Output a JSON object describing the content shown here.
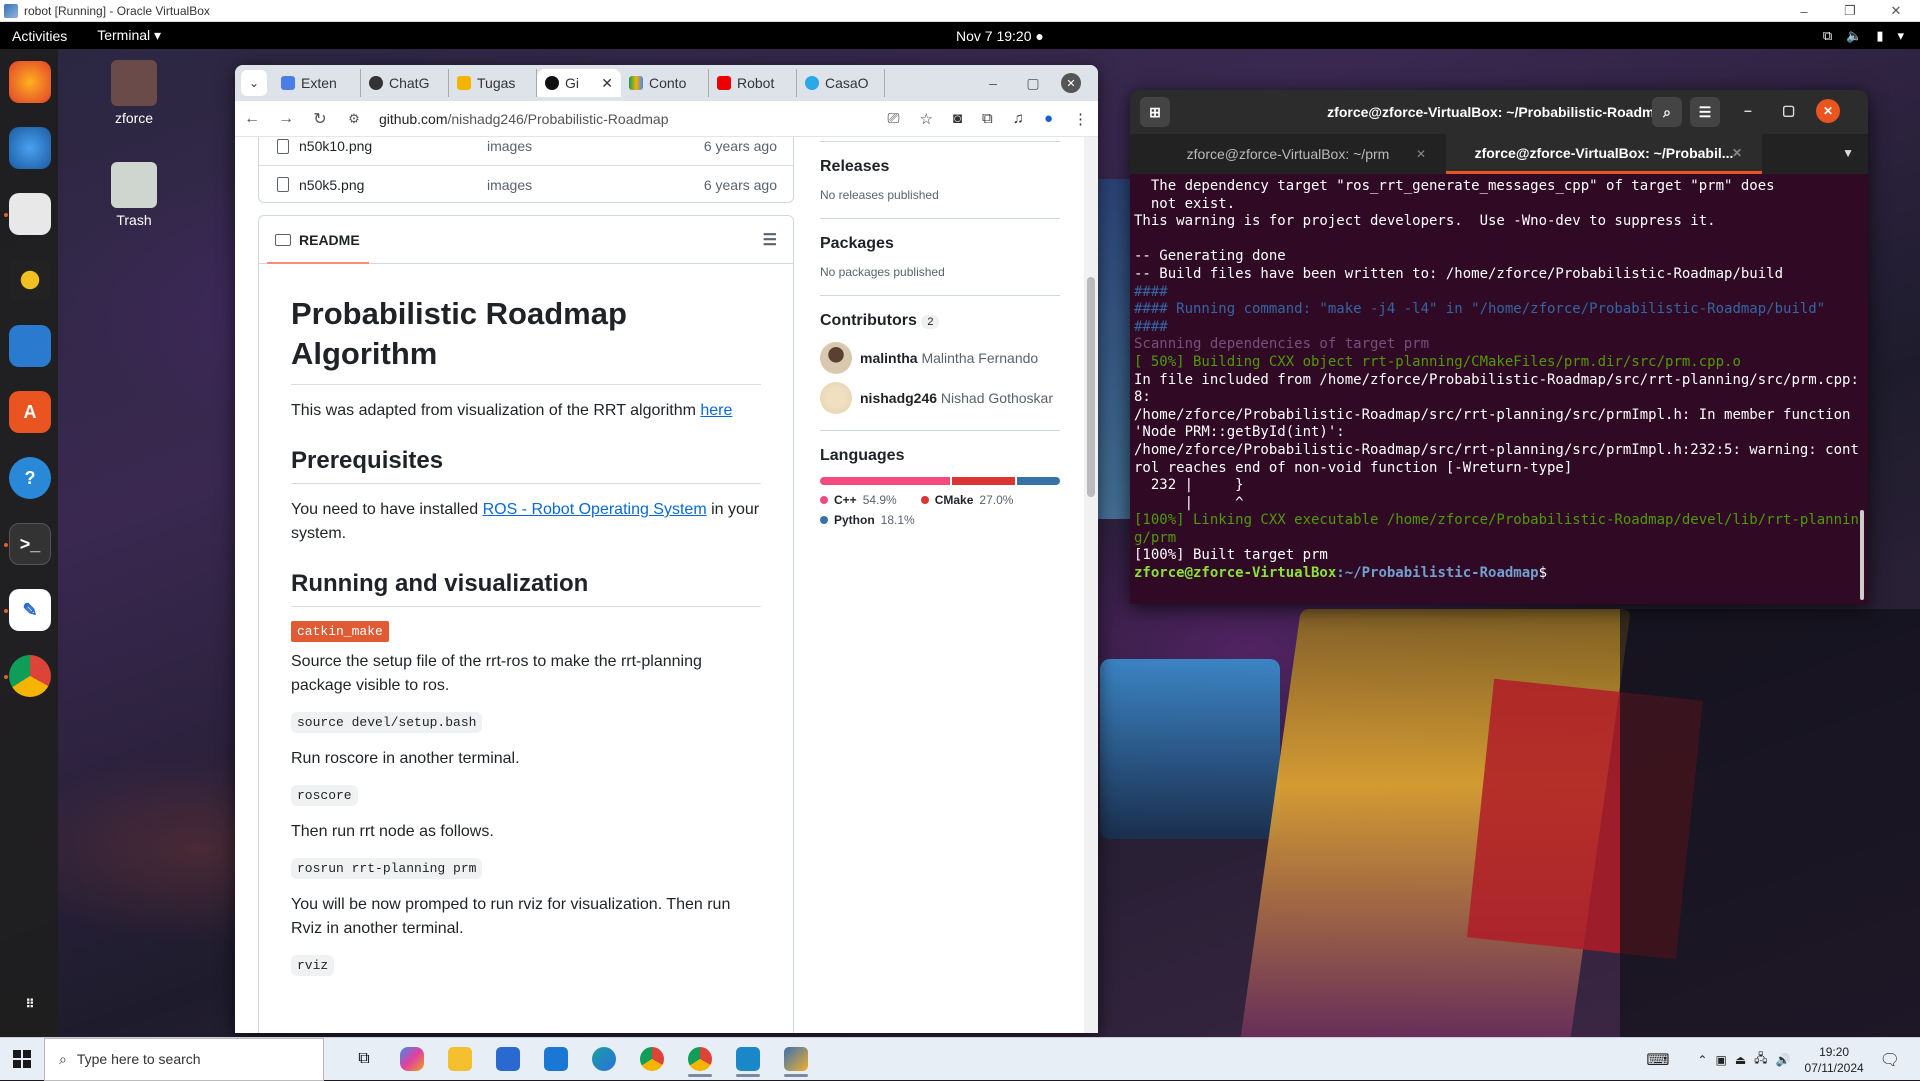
{
  "host": {
    "title": "robot [Running] - Oracle VirtualBox"
  },
  "topbar": {
    "activities": "Activities",
    "app_menu": "Terminal ▾",
    "clock": "Nov 7  19:20"
  },
  "desktop_icons": [
    {
      "label": "zforce"
    },
    {
      "label": "Trash"
    }
  ],
  "browser": {
    "tabs": [
      "Exten",
      "ChatG",
      "Tugas",
      "Gi",
      "Conto",
      "Robot",
      "CasaO"
    ],
    "url_host": "github.com",
    "url_path": "/nishadg246/Probabilistic-Roadmap",
    "files": [
      {
        "name": "n50k10.png",
        "commit": "images",
        "date": "6 years ago"
      },
      {
        "name": "n50k5.png",
        "commit": "images",
        "date": "6 years ago"
      }
    ],
    "readme_tab": "README",
    "readme": {
      "title": "Probabilistic Roadmap Algorithm",
      "intro": "This was adapted from visualization of the RRT algorithm ",
      "intro_link": "here",
      "h_prereq": "Prerequisites",
      "prereq_pre": "You need to have installed ",
      "prereq_link": "ROS - Robot Operating System",
      "prereq_post": " in your system.",
      "h_run": "Running and visualization",
      "code1": "catkin_make",
      "p1": "Source the setup file of the rrt-ros to make the rrt-planning package visible to ros.",
      "code2": "source devel/setup.bash",
      "p2": "Run roscore in another terminal.",
      "code3": "roscore",
      "p3": "Then run rrt node as follows.",
      "code4": "rosrun rrt-planning prm",
      "p4": "You will be now promped to run rviz for visualization. Then run Rviz in another terminal.",
      "code5": "rviz"
    },
    "sidebar": {
      "releases_title": "Releases",
      "releases_text": "No releases published",
      "packages_title": "Packages",
      "packages_text": "No packages published",
      "contributors_title": "Contributors",
      "contributors_count": "2",
      "contributors": [
        {
          "login": "malintha",
          "name": "Malintha Fernando"
        },
        {
          "login": "nishadg246",
          "name": "Nishad Gothoskar"
        }
      ],
      "languages_title": "Languages",
      "languages": [
        {
          "name": "C++",
          "pct": "54.9%",
          "value": 54.9,
          "color": "#f34b7d"
        },
        {
          "name": "CMake",
          "pct": "27.0%",
          "value": 27.0,
          "color": "#da3434"
        },
        {
          "name": "Python",
          "pct": "18.1%",
          "value": 18.1,
          "color": "#3572A5"
        }
      ]
    }
  },
  "terminal": {
    "title": "zforce@zforce-VirtualBox: ~/Probabilistic-Roadmap",
    "tabs": [
      "zforce@zforce-VirtualBox: ~/prm",
      "zforce@zforce-VirtualBox: ~/Probabil..."
    ],
    "lines": [
      {
        "text": "  The dependency target \"ros_rrt_generate_messages_cpp\" of target \"prm\" does\n  not exist.",
        "color": "#ffffff"
      },
      {
        "text": "This warning is for project developers.  Use -Wno-dev to suppress it.",
        "color": "#ffffff"
      },
      {
        "text": " ",
        "color": "#ffffff"
      },
      {
        "text": "-- Generating done",
        "color": "#ffffff"
      },
      {
        "text": "-- Build files have been written to: /home/zforce/Probabilistic-Roadmap/build",
        "color": "#ffffff"
      },
      {
        "text": "####",
        "color": "#3465a4"
      },
      {
        "text": "#### Running command: \"make -j4 -l4\" in \"/home/zforce/Probabilistic-Roadmap/build\"",
        "color": "#3465a4"
      },
      {
        "text": "####",
        "color": "#3465a4"
      },
      {
        "text": "Scanning dependencies of target prm",
        "color": "#75507b"
      },
      {
        "text": "[ 50%] Building CXX object rrt-planning/CMakeFiles/prm.dir/src/prm.cpp.o",
        "color": "#4e9a06"
      },
      {
        "text": "In file included from /home/zforce/Probabilistic-Roadmap/src/rrt-planning/src/prm.cpp:8:",
        "color": "#ffffff"
      },
      {
        "text": "/home/zforce/Probabilistic-Roadmap/src/rrt-planning/src/prmImpl.h: In member function 'Node PRM::getById(int)':",
        "color": "#ffffff"
      },
      {
        "text": "/home/zforce/Probabilistic-Roadmap/src/rrt-planning/src/prmImpl.h:232:5: warning: control reaches end of non-void function [-Wreturn-type]",
        "color": "#ffffff"
      },
      {
        "text": "  232 |     }",
        "color": "#ffffff"
      },
      {
        "text": "      |     ^",
        "color": "#ffffff"
      },
      {
        "text": "[100%] Linking CXX executable /home/zforce/Probabilistic-Roadmap/devel/lib/rrt-planning/prm",
        "color": "#4e9a06"
      },
      {
        "text": "[100%] Built target prm",
        "color": "#ffffff"
      }
    ],
    "prompt_user": "zforce@zforce-VirtualBox",
    "prompt_path": ":~/Probabilistic-Roadmap",
    "prompt_end": "$"
  },
  "taskbar": {
    "search_placeholder": "Type here to search",
    "time": "19:20",
    "date": "07/11/2024"
  }
}
